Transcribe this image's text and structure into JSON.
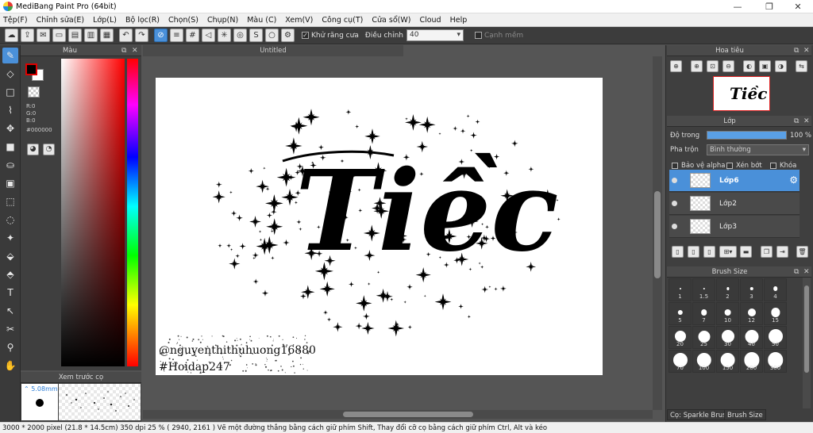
{
  "window": {
    "title": "MediBang Paint Pro (64bit)",
    "minimize": "—",
    "maximize": "❐",
    "close": "✕"
  },
  "menu": [
    "Tệp(F)",
    "Chỉnh sửa(E)",
    "Lớp(L)",
    "Bộ lọc(R)",
    "Chọn(S)",
    "Chụp(N)",
    "Màu (C)",
    "Xem(V)",
    "Công cụ(T)",
    "Cửa sổ(W)",
    "Cloud",
    "Help"
  ],
  "toolbar": {
    "antialias_label": "Khử răng cưa",
    "adjust_label": "Điều chỉnh",
    "adjust_value": "40",
    "edge_label": "Cạnh mềm"
  },
  "color_panel": {
    "title": "Màu",
    "r": "R:0",
    "g": "G:0",
    "b": "B:0",
    "hex": "#000000",
    "fg_color": "#000000",
    "bg_color": "#ffffff"
  },
  "brush_preview": {
    "title": "Xem trước cọ",
    "size": "5.08mm"
  },
  "document": {
    "tab": "Untitled",
    "word": "Tiềc",
    "credit1": "@nguyenthithuhuong16880",
    "credit2": "#Hoidap247"
  },
  "navigator": {
    "title": "Hoa tiêu"
  },
  "layer_panel": {
    "title": "Lớp",
    "opacity_label": "Độ trong",
    "opacity_value": "100 %",
    "opacity": 1.0,
    "blend_label": "Pha trộn",
    "blend_value": "Bình thường",
    "protect_alpha": "Bảo vệ alpha",
    "clipping": "Xén bớt",
    "lock": "Khóa",
    "layers": [
      {
        "name": "Lớp6",
        "selected": true
      },
      {
        "name": "Lớp2",
        "selected": false
      },
      {
        "name": "Lớp3",
        "selected": false
      }
    ]
  },
  "brush_size": {
    "title": "Brush Size",
    "sizes": [
      "1",
      "1.5",
      "2",
      "3",
      "4",
      "5",
      "7",
      "10",
      "12",
      "15",
      "20",
      "25",
      "30",
      "40",
      "50",
      "70",
      "100",
      "150",
      "200",
      "300"
    ],
    "tab_brush": "Cọ: Sparkle Brush",
    "tab_size": "Brush Size"
  },
  "status": "3000 * 2000 pixel   (21.8 * 14.5cm)   350 dpi   25 %   ( 2940, 2161 )   Vẽ một đường thẳng bằng cách giữ phím Shift, Thay đổi cỡ cọ bằng cách giữ phím Ctrl, Alt và kéo"
}
